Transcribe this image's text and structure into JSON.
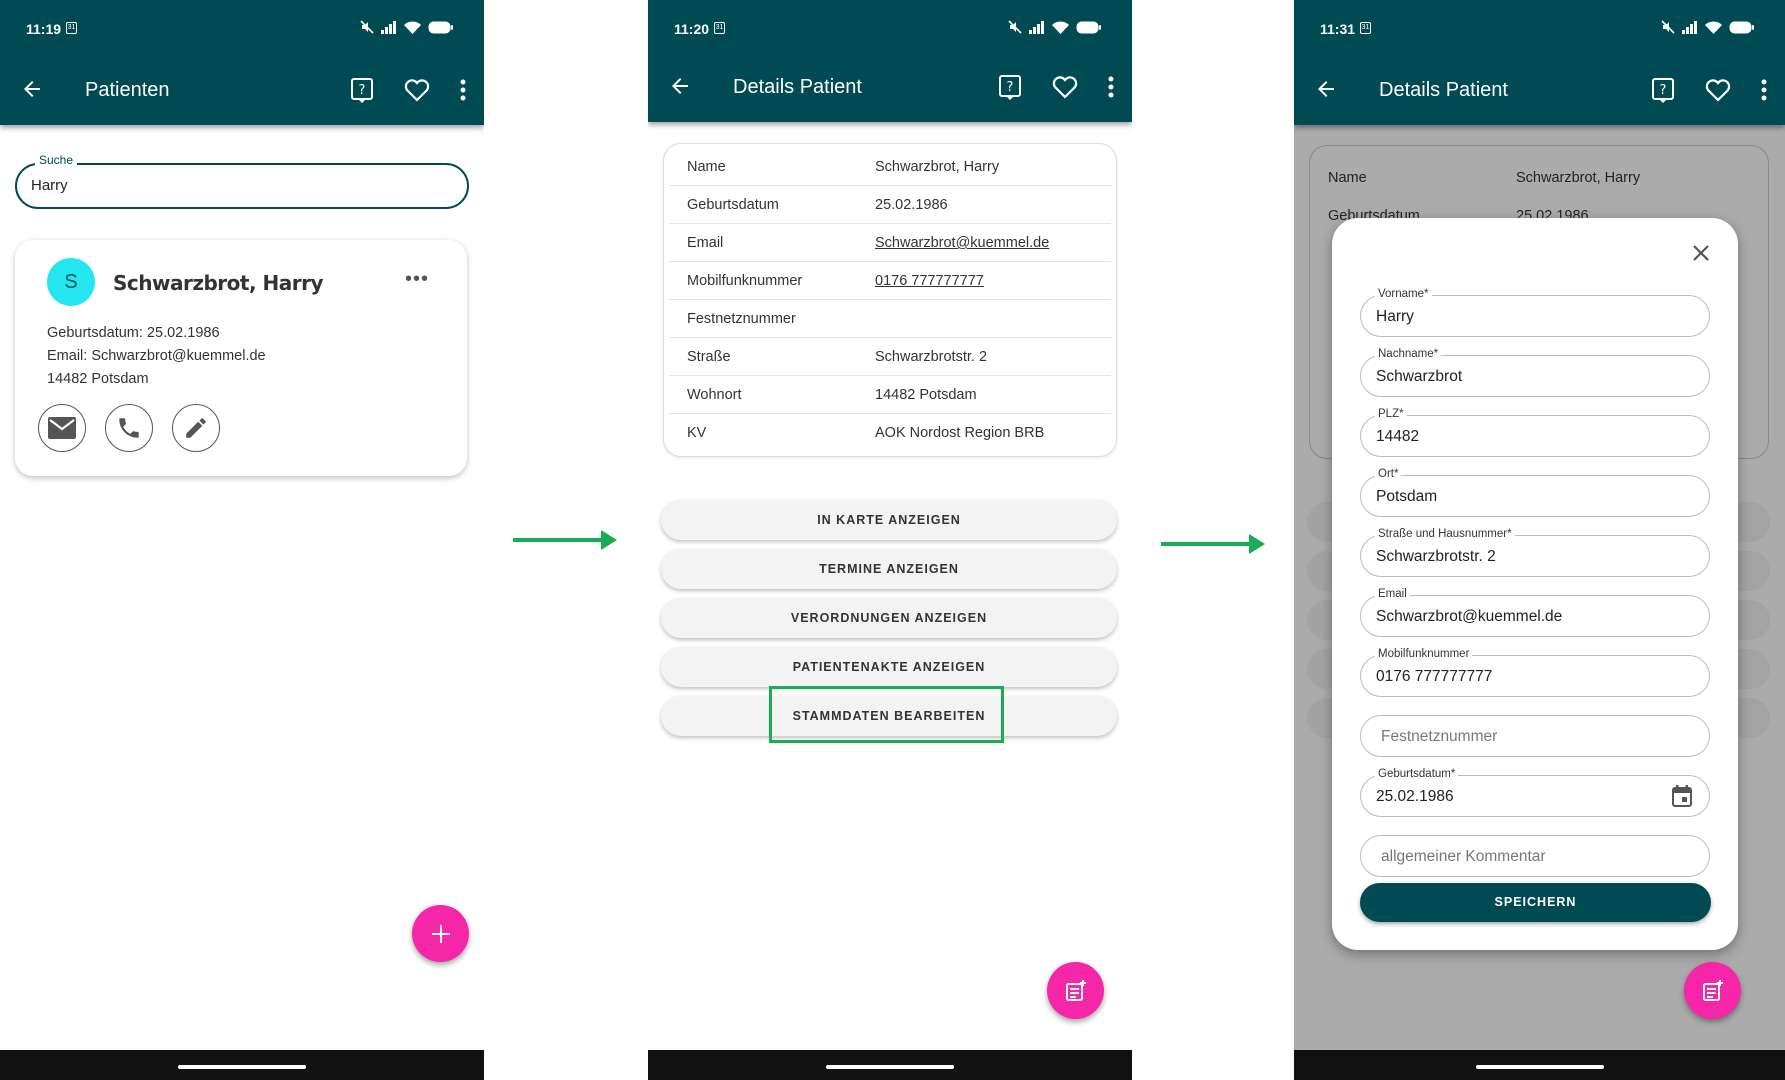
{
  "colors": {
    "primary": "#004a54",
    "fab": "#f526a8",
    "avatar": "#25e5ee",
    "highlight": "#1aab55"
  },
  "screen1": {
    "time": "11:19",
    "title": "Patienten",
    "search": {
      "label": "Suche",
      "value": "Harry"
    },
    "card": {
      "initial": "S",
      "name": "Schwarzbrot, Harry",
      "birth": "Geburtsdatum: 25.02.1986",
      "email": "Email: Schwarzbrot@kuemmel.de",
      "city": "14482 Potsdam"
    },
    "fab_icon": "plus-icon"
  },
  "screen2": {
    "time": "11:20",
    "title": "Details Patient",
    "details": [
      {
        "key": "Name",
        "value": "Schwarzbrot, Harry"
      },
      {
        "key": "Geburtsdatum",
        "value": "25.02.1986"
      },
      {
        "key": "Email",
        "value": "Schwarzbrot@kuemmel.de"
      },
      {
        "key": "Mobilfunknummer",
        "value": "0176 777777777"
      },
      {
        "key": "Festnetznummer",
        "value": ""
      },
      {
        "key": "Straße",
        "value": "Schwarzbrotstr. 2"
      },
      {
        "key": "Wohnort",
        "value": "14482 Potsdam"
      },
      {
        "key": "KV",
        "value": "AOK Nordost Region BRB"
      }
    ],
    "buttons": [
      "IN KARTE ANZEIGEN",
      "TERMINE ANZEIGEN",
      "VERORDNUNGEN ANZEIGEN",
      "PATIENTENAKTE ANZEIGEN",
      "STAMMDATEN BEARBEITEN"
    ],
    "fab_icon": "note-add-icon"
  },
  "screen3": {
    "time": "11:31",
    "title": "Details Patient",
    "bg_rows": [
      {
        "key": "Name",
        "value": "Schwarzbrot, Harry"
      },
      {
        "key": "Geburtsdatum",
        "value": "25.02.1986"
      }
    ],
    "form": {
      "vorname": {
        "label": "Vorname*",
        "value": "Harry"
      },
      "nachname": {
        "label": "Nachname*",
        "value": "Schwarzbrot"
      },
      "plz": {
        "label": "PLZ*",
        "value": "14482"
      },
      "ort": {
        "label": "Ort*",
        "value": "Potsdam"
      },
      "strasse": {
        "label": "Straße und Hausnummer*",
        "value": "Schwarzbrotstr. 2"
      },
      "email": {
        "label": "Email",
        "value": "Schwarzbrot@kuemmel.de"
      },
      "mobil": {
        "label": "Mobilfunknummer",
        "value": "0176 777777777"
      },
      "festnetz": {
        "placeholder": "Festnetznummer"
      },
      "geburt": {
        "label": "Geburtsdatum*",
        "value": "25.02.1986"
      },
      "kommentar": {
        "placeholder": "allgemeiner Kommentar"
      }
    },
    "save_label": "SPEICHERN",
    "fab_icon": "note-add-icon"
  }
}
